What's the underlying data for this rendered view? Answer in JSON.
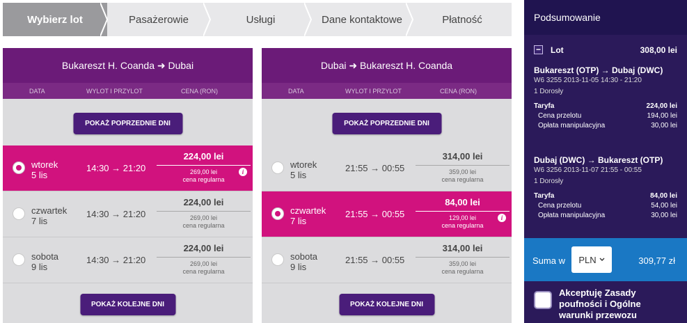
{
  "steps": [
    {
      "label": "Wybierz lot",
      "active": true
    },
    {
      "label": "Pasażerowie",
      "active": false
    },
    {
      "label": "Usługi",
      "active": false
    },
    {
      "label": "Dane kontaktowe",
      "active": false
    },
    {
      "label": "Płatność",
      "active": false
    }
  ],
  "columns": {
    "date": "DATA",
    "times": "WYLOT I PRZYLOT",
    "price": "CENA (RON)"
  },
  "buttons": {
    "prev": "POKAŻ POPRZEDNIE DNI",
    "next": "POKAŻ KOLEJNE DNI"
  },
  "outbound": {
    "title": "Bukareszt H. Coanda ➜ Dubai",
    "rows": [
      {
        "day": "wtorek",
        "date": "5 lis",
        "times": "14:30 → 21:20",
        "price": "224,00 lei",
        "regular": "269,00 lei",
        "regular_label": "cena regularna",
        "selected": true
      },
      {
        "day": "czwartek",
        "date": "7 lis",
        "times": "14:30 → 21:20",
        "price": "224,00 lei",
        "regular": "269,00 lei",
        "regular_label": "cena regularna",
        "selected": false
      },
      {
        "day": "sobota",
        "date": "9 lis",
        "times": "14:30 → 21:20",
        "price": "224,00 lei",
        "regular": "269,00 lei",
        "regular_label": "cena regularna",
        "selected": false
      }
    ]
  },
  "inbound": {
    "title": "Dubai ➜ Bukareszt H. Coanda",
    "rows": [
      {
        "day": "wtorek",
        "date": "5 lis",
        "times": "21:55 → 00:55",
        "price": "314,00 lei",
        "regular": "359,00 lei",
        "regular_label": "cena regularna",
        "selected": false
      },
      {
        "day": "czwartek",
        "date": "7 lis",
        "times": "21:55 → 00:55",
        "price": "84,00 lei",
        "regular": "129,00 lei",
        "regular_label": "cena regularna",
        "selected": true
      },
      {
        "day": "sobota",
        "date": "9 lis",
        "times": "21:55 → 00:55",
        "price": "314,00 lei",
        "regular": "359,00 lei",
        "regular_label": "cena regularna",
        "selected": false
      }
    ]
  },
  "summary": {
    "title": "Podsumowanie",
    "lot_label": "Lot",
    "lot_total": "308,00 lei",
    "legs": [
      {
        "route": "Bukareszt (OTP) → Dubaj (DWC)",
        "flight": "W6 3255  2013-11-05 14:30 - 21:20",
        "pax": "1 Dorosły",
        "fare_label": "Taryfa",
        "fare": "224,00 lei",
        "base_label": "Cena przelotu",
        "base": "194,00 lei",
        "fee_label": "Opłata manipulacyjna",
        "fee": "30,00 lei"
      },
      {
        "route": "Dubaj (DWC) → Bukareszt (OTP)",
        "flight": "W6 3256  2013-11-07 21:55 - 00:55",
        "pax": "1 Dorosły",
        "fare_label": "Taryfa",
        "fare": "84,00 lei",
        "base_label": "Cena przelotu",
        "base": "54,00 lei",
        "fee_label": "Opłata manipulacyjna",
        "fee": "30,00 lei"
      }
    ],
    "sum_label": "Suma w",
    "currency": "PLN",
    "sum_amount": "309,77 zł",
    "accept_text": "Akceptuję Zasady poufności i Ogólne warunki przewozu"
  }
}
